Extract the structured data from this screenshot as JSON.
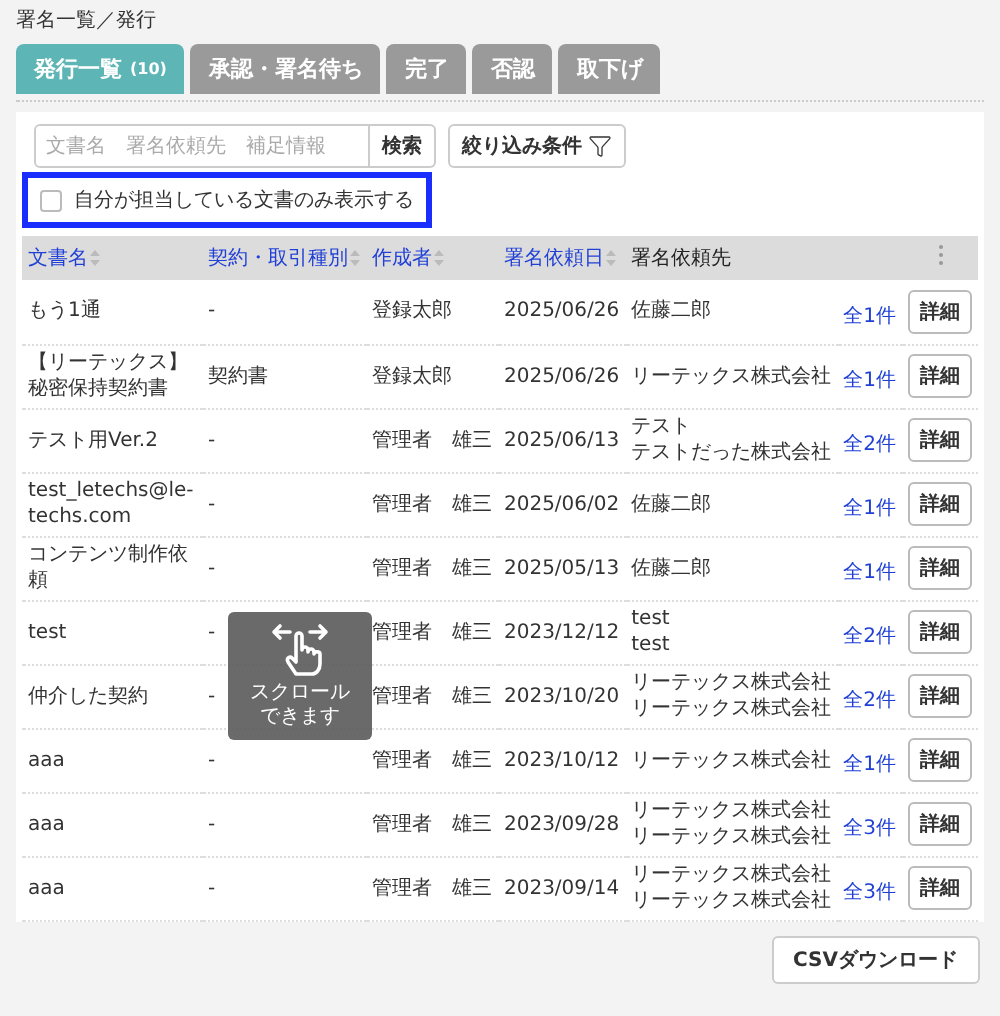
{
  "breadcrumb": "署名一覧／発行",
  "tabs": [
    {
      "label": "発行一覧",
      "count": "(10)",
      "selected": true
    },
    {
      "label": "承認・署名待ち",
      "selected": false
    },
    {
      "label": "完了",
      "selected": false
    },
    {
      "label": "否認",
      "selected": false
    },
    {
      "label": "取下げ",
      "selected": false
    }
  ],
  "search": {
    "placeholder": "文書名　署名依頼先　補足情報",
    "button": "検索"
  },
  "filter_button": "絞り込み条件",
  "own_docs_checkbox": {
    "label": "自分が担当している文書のみ表示する",
    "checked": false,
    "highlighted": true
  },
  "table": {
    "columns": [
      {
        "label": "文書名",
        "sortable": true
      },
      {
        "label": "契約・取引種別",
        "sortable": true
      },
      {
        "label": "作成者",
        "sortable": true
      },
      {
        "label": "署名依頼日",
        "sortable": true
      },
      {
        "label": "署名依頼先",
        "sortable": false
      }
    ],
    "rows": [
      {
        "document_name": "もう1通",
        "contract_type": "-",
        "creator": "登録太郎",
        "request_date": "2025/06/26",
        "signers": [
          "佐藤二郎"
        ],
        "count": "全1件",
        "action": "詳細"
      },
      {
        "document_name": "【リーテックス】秘密保持契約書",
        "contract_type": "契約書",
        "creator": "登録太郎",
        "request_date": "2025/06/26",
        "signers": [
          "リーテックス株式会社"
        ],
        "count": "全1件",
        "action": "詳細"
      },
      {
        "document_name": "テスト用Ver.2",
        "contract_type": "-",
        "creator": "管理者　雄三",
        "request_date": "2025/06/13",
        "signers": [
          "テスト",
          "テストだった株式会社"
        ],
        "count": "全2件",
        "action": "詳細"
      },
      {
        "document_name": "test_letechs@le-techs.com",
        "contract_type": "-",
        "creator": "管理者　雄三",
        "request_date": "2025/06/02",
        "signers": [
          "佐藤二郎"
        ],
        "count": "全1件",
        "action": "詳細"
      },
      {
        "document_name": "コンテンツ制作依頼",
        "contract_type": "-",
        "creator": "管理者　雄三",
        "request_date": "2025/05/13",
        "signers": [
          "佐藤二郎"
        ],
        "count": "全1件",
        "action": "詳細"
      },
      {
        "document_name": "test",
        "contract_type": "-",
        "creator": "管理者　雄三",
        "request_date": "2023/12/12",
        "signers": [
          "test",
          "test"
        ],
        "count": "全2件",
        "action": "詳細"
      },
      {
        "document_name": "仲介した契約",
        "contract_type": "-",
        "creator": "管理者　雄三",
        "request_date": "2023/10/20",
        "signers": [
          "リーテックス株式会社",
          "リーテックス株式会社"
        ],
        "count": "全2件",
        "action": "詳細"
      },
      {
        "document_name": "aaa",
        "contract_type": "-",
        "creator": "管理者　雄三",
        "request_date": "2023/10/12",
        "signers": [
          "リーテックス株式会社"
        ],
        "count": "全1件",
        "action": "詳細"
      },
      {
        "document_name": "aaa",
        "contract_type": "-",
        "creator": "管理者　雄三",
        "request_date": "2023/09/28",
        "signers": [
          "リーテックス株式会社",
          "リーテックス株式会社"
        ],
        "count": "全3件",
        "action": "詳細"
      },
      {
        "document_name": "aaa",
        "contract_type": "-",
        "creator": "管理者　雄三",
        "request_date": "2023/09/14",
        "signers": [
          "リーテックス株式会社",
          "リーテックス株式会社"
        ],
        "count": "全3件",
        "action": "詳細"
      }
    ]
  },
  "scroll_hint": {
    "text": "スクロールできます"
  },
  "csv_button": "CSVダウンロード"
}
